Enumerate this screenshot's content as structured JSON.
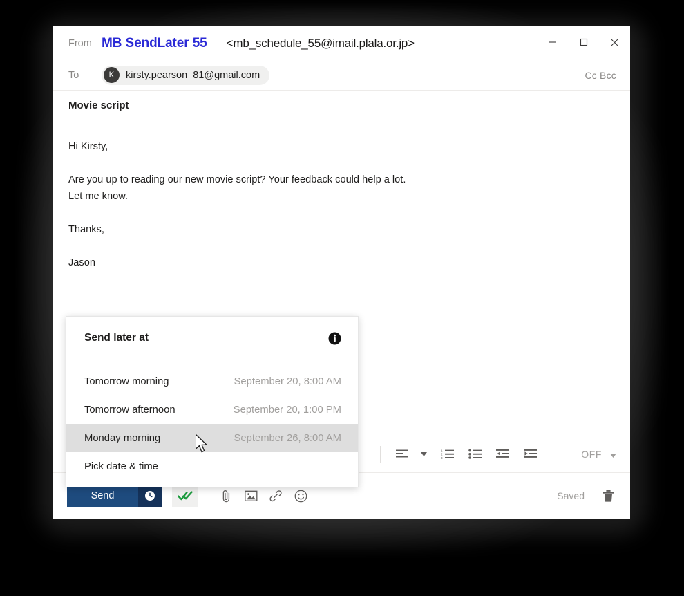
{
  "window": {
    "controls": {
      "minimize_label": "Minimize",
      "maximize_label": "Maximize",
      "close_label": "Close"
    }
  },
  "compose": {
    "from": {
      "label": "From",
      "display_name": "MB SendLater 55",
      "address": "<mb_schedule_55@imail.plala.or.jp>",
      "name_color": "#2b2ad6"
    },
    "to": {
      "label": "To",
      "avatar_initial": "K",
      "recipient": "kirsty.pearson_81@gmail.com",
      "ccbcc_label": "Cc Bcc"
    },
    "subject": "Movie script",
    "body": {
      "greeting": "Hi Kirsty,",
      "paragraph": "Are you up to reading our new movie script? Your feedback could help a lot.",
      "paragraph_line2": "Let me know.",
      "closing": "Thanks,",
      "signature": "Jason"
    }
  },
  "format_toolbar": {
    "align_label": "align-left",
    "align_caret_label": "align-options",
    "numbered_list_label": "numbered-list",
    "bulleted_list_label": "bulleted-list",
    "decrease_indent_label": "decrease-indent",
    "increase_indent_label": "increase-indent",
    "toggle_state": "OFF"
  },
  "action_bar": {
    "send_label": "Send",
    "send_later_label": "schedule-send",
    "read_receipt_label": "double-check",
    "attach_file_label": "attach-file",
    "insert_picture_label": "insert-picture",
    "insert_link_label": "insert-link",
    "insert_emoji_label": "insert-emoji",
    "status_text": "Saved",
    "discard_label": "discard-draft",
    "send_color": "#1e4b7e",
    "send_split_color": "#15325a"
  },
  "send_later_popover": {
    "title": "Send later at",
    "info_label": "info",
    "options": [
      {
        "label": "Tomorrow morning",
        "when": "September 20, 8:00 AM",
        "selected": false
      },
      {
        "label": "Tomorrow afternoon",
        "when": "September 20, 1:00 PM",
        "selected": false
      },
      {
        "label": "Monday morning",
        "when": "September 26, 8:00 AM",
        "selected": true
      },
      {
        "label": "Pick date & time",
        "when": "",
        "selected": false
      }
    ]
  }
}
